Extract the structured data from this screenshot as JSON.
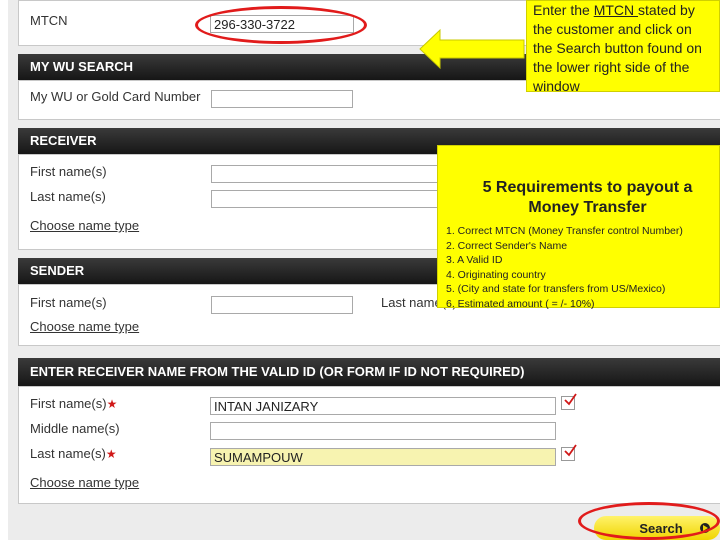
{
  "colors": {
    "band": "#222222",
    "callout": "#ffff00",
    "highlight": "#e11b1b",
    "button": "#f0d400"
  },
  "mtcn": {
    "label": "MTCN",
    "value": "296-330-3722"
  },
  "callout_note": {
    "pre": "Enter the ",
    "keyword": "MTCN ",
    "post": "stated by the customer and click on the Search button found on the lower right side of the window"
  },
  "my_wu_search": {
    "heading": "MY WU SEARCH",
    "card_label": "My WU or Gold Card Number",
    "card_value": ""
  },
  "receiver": {
    "heading": "RECEIVER",
    "first_label": "First name(s)",
    "last_label": "Last name(s)",
    "name_type_link": "Choose name type"
  },
  "requirements": {
    "title": "5 Requirements to payout a Money Transfer",
    "items": [
      "1. Correct MTCN (Money Transfer control Number)",
      "2. Correct Sender's Name",
      "3. A Valid ID",
      "4. Originating country",
      "5. (City and state for transfers from US/Mexico)",
      "6. Estimated amount ( = /- 10%)"
    ]
  },
  "sender": {
    "heading": "SENDER",
    "first_label": "First name(s)",
    "last_label": "Last name(s)",
    "name_type_link": "Choose name type"
  },
  "id_receiver": {
    "heading": "ENTER RECEIVER NAME FROM THE VALID ID (OR FORM IF ID NOT REQUIRED)",
    "first_label": "First name(s)",
    "first_value": "INTAN JANIZARY",
    "middle_label": "Middle name(s)",
    "middle_value": "",
    "last_label": "Last name(s)",
    "last_value": "SUMAMPOUW",
    "required_mark": "★",
    "name_type_link": "Choose name type"
  },
  "search_button": {
    "label": "Search",
    "icon": "arrow-right-circle-icon"
  }
}
